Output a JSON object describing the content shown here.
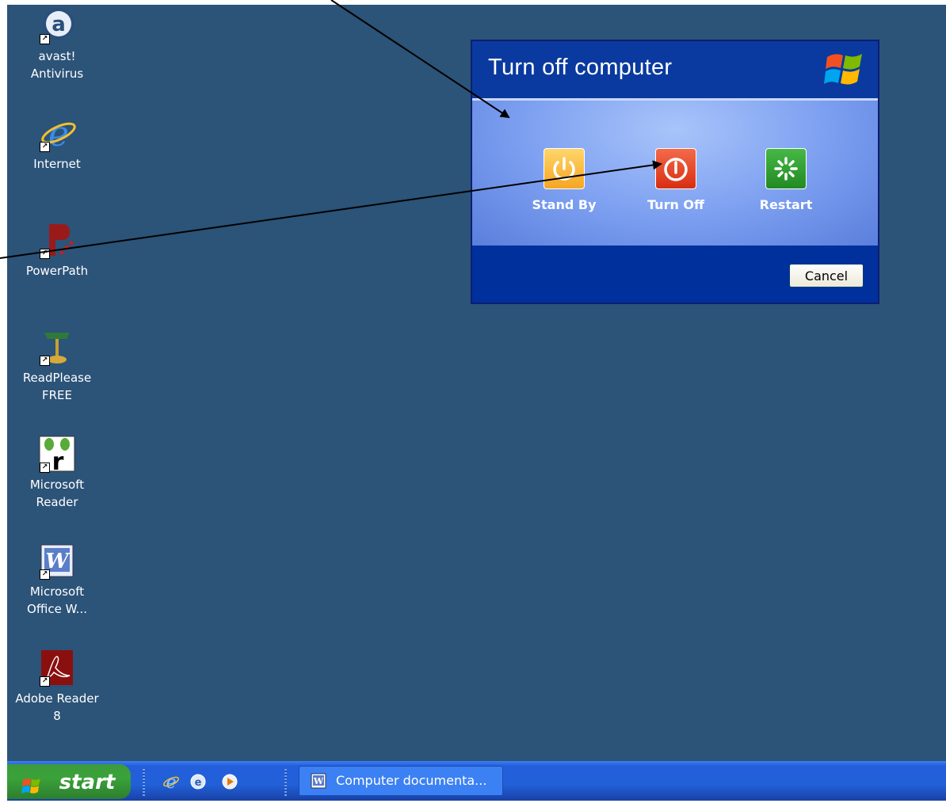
{
  "desktop": {
    "background": "#2c5378",
    "icons": [
      {
        "label": "avast!\nAntivirus",
        "icon": "avast-icon"
      },
      {
        "label": "Internet",
        "icon": "internet-explorer-icon"
      },
      {
        "label": "PowerPath",
        "icon": "powerpath-icon"
      },
      {
        "label": "ReadPlease\nFREE",
        "icon": "desk-lamp-icon"
      },
      {
        "label": "Microsoft\nReader",
        "icon": "microsoft-reader-icon"
      },
      {
        "label": "Microsoft\nOffice W...",
        "icon": "word-icon"
      },
      {
        "label": "Adobe Reader\n8",
        "icon": "adobe-reader-icon"
      }
    ]
  },
  "dialog": {
    "title": "Turn off computer",
    "options": [
      {
        "label": "Stand By",
        "icon": "stand-by-icon",
        "color": "#f5a623"
      },
      {
        "label": "Turn Off",
        "icon": "power-icon",
        "color": "#e0391b"
      },
      {
        "label": "Restart",
        "icon": "restart-icon",
        "color": "#2c9a2c"
      }
    ],
    "cancel_label": "Cancel"
  },
  "taskbar": {
    "start_label": "start",
    "quick_launch": [
      "internet-explorer-icon",
      "outlook-express-icon",
      "media-player-icon"
    ],
    "task_button_label": "Computer documenta..."
  }
}
